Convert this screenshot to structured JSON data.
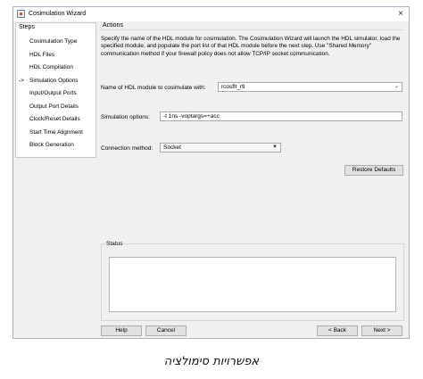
{
  "window": {
    "title": "Cosimulation Wizard",
    "close_glyph": "×"
  },
  "steps": {
    "header": "Steps",
    "current_marker": "->",
    "items": [
      {
        "label": "Cosimulation Type",
        "current": false
      },
      {
        "label": "HDL Files",
        "current": false
      },
      {
        "label": "HDL Compilation",
        "current": false
      },
      {
        "label": "Simulation Options",
        "current": true
      },
      {
        "label": "Input/Output Ports",
        "current": false
      },
      {
        "label": "Output Port Details",
        "current": false
      },
      {
        "label": "Clock/Reset Details",
        "current": false
      },
      {
        "label": "Start Time Alignment",
        "current": false
      },
      {
        "label": "Block Generation",
        "current": false
      }
    ]
  },
  "actions": {
    "header": "Actions",
    "description": "Specify the name of the HDL module for cosimulation. The Cosimulation Wizard will launch the HDL simulator, load the specified module, and populate the port list of that HDL module before the next step. Use \"Shared Memory\" communication method if your firewall policy does not allow  TCP/IP socket communication.",
    "module_label": "Name of HDL module to cosimulate with:",
    "module_value": "rcosflt_rtl",
    "sim_options_label": "Simulation options:",
    "sim_options_value": "-t 1ns -voptargs=+acc",
    "connection_label": "Connection method:",
    "connection_value": "Socket",
    "restore_label": "Restore Defaults"
  },
  "status": {
    "label": "Status",
    "text": ""
  },
  "footer": {
    "help": "Help",
    "cancel": "Cancel",
    "back": "< Back",
    "next": "Next >"
  },
  "caption": "אפשרויות סימולציה"
}
